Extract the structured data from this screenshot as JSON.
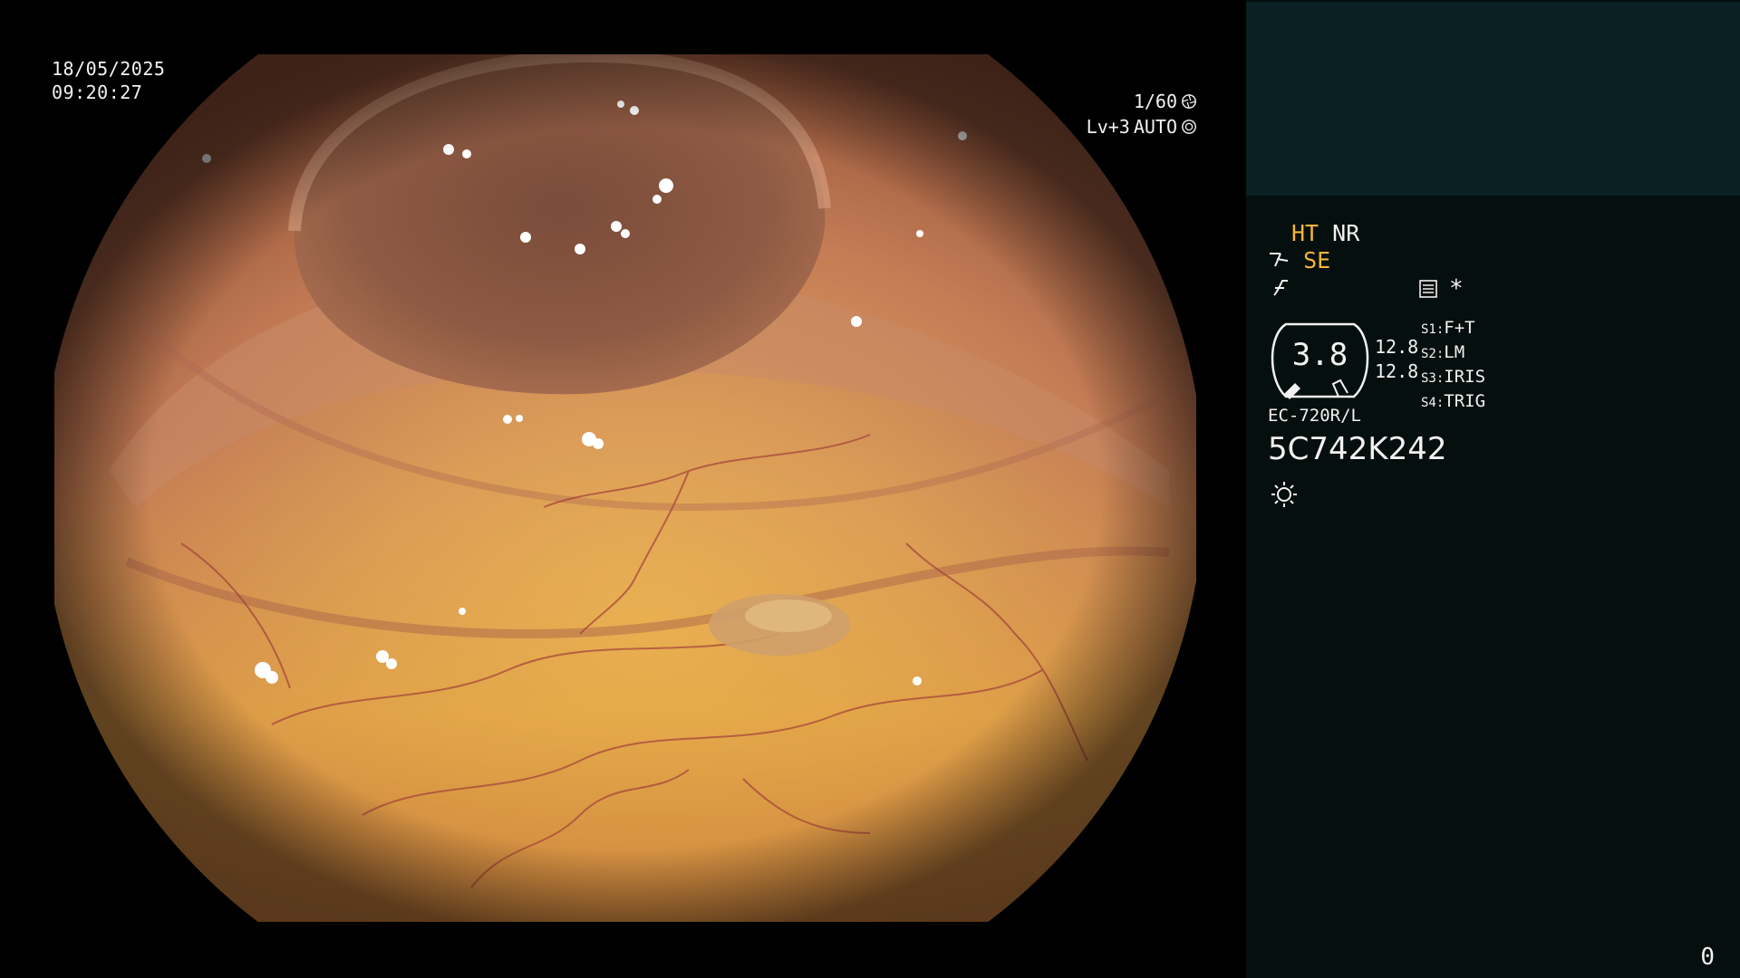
{
  "overlay": {
    "date": "18/05/2025",
    "time": "09:20:27",
    "shutter": "1/60",
    "light_level": "Lv+3",
    "light_mode": "AUTO"
  },
  "panel": {
    "enhancement_1": "HT",
    "enhancement_2": "NR",
    "structure_mode": "SE",
    "gauge_value": "3.8",
    "gauge_right_top": "12.8",
    "gauge_right_bottom": "12.8",
    "switches": [
      {
        "key": "S1",
        "value": "F+T"
      },
      {
        "key": "S2",
        "value": "LM"
      },
      {
        "key": "S3",
        "value": "IRIS"
      },
      {
        "key": "S4",
        "value": "TRIG"
      }
    ],
    "scope_model": "EC-720R/L",
    "scope_serial": "5C742K242",
    "frame_counter": "0",
    "colors": {
      "accent": "#f4b53a",
      "panel_top": "#0b2022",
      "panel_bg": "#050f0e"
    },
    "icons": [
      "scope-tip-icon",
      "curve-icon",
      "memo-icon",
      "asterisk-icon",
      "brightness-icon",
      "shutter-icon",
      "iris-icon"
    ]
  }
}
